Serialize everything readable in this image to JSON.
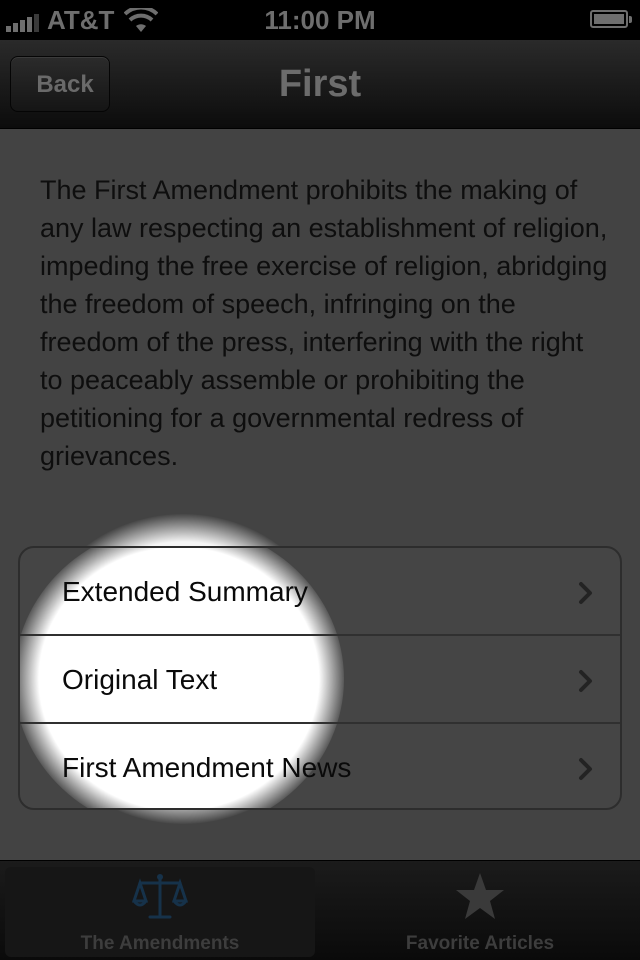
{
  "status_bar": {
    "carrier": "AT&T",
    "time": "11:00 PM"
  },
  "nav": {
    "back_label": "Back",
    "title": "First"
  },
  "description": "The First Amendment prohibits the making of any law respecting an establishment of religion, impeding the free exercise of religion, abridging the freedom of speech, infringing on the freedom of the press, interfering with the right to peaceably assemble or prohibiting the petitioning for a governmental redress of grievances.",
  "menu": {
    "items": [
      {
        "label": "Extended Summary",
        "icon": "chevron-right-icon"
      },
      {
        "label": "Original Text",
        "icon": "chevron-right-icon"
      },
      {
        "label": "First Amendment News",
        "icon": "chevron-right-icon"
      }
    ]
  },
  "tab_bar": {
    "tabs": [
      {
        "label": "The Amendments",
        "icon": "scales-icon",
        "selected": true
      },
      {
        "label": "Favorite Articles",
        "icon": "star-icon",
        "selected": false
      }
    ]
  },
  "colors": {
    "content_background": "#434343",
    "tab_icon_selected": "#16324a",
    "spotlight": "#ffffff"
  }
}
